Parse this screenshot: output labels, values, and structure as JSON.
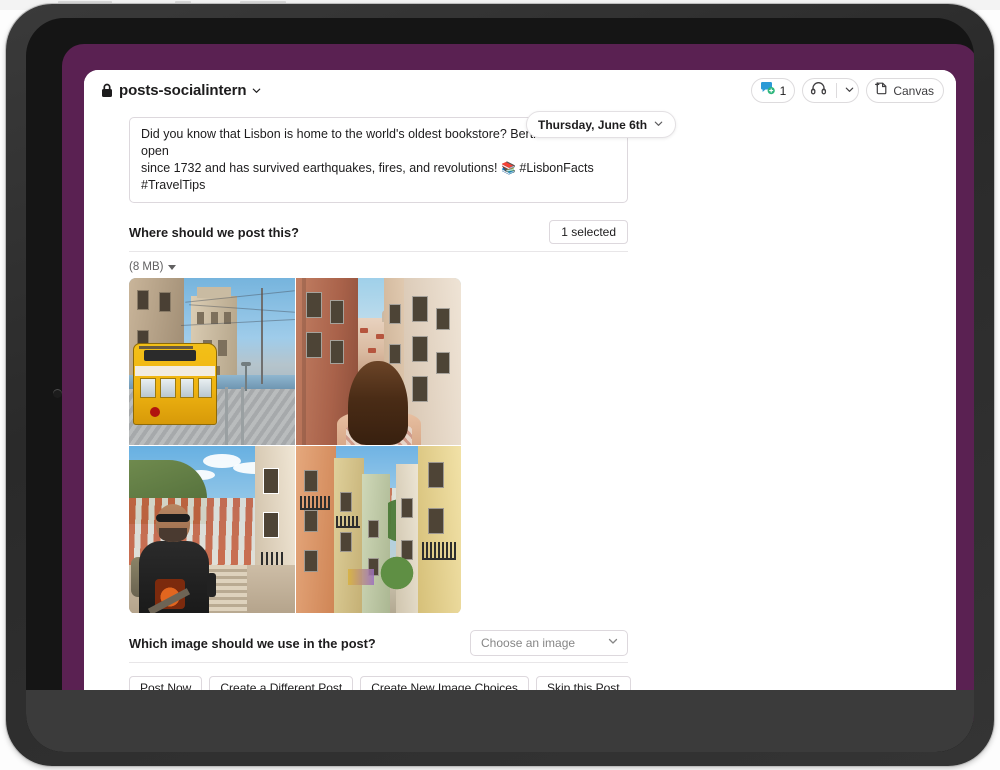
{
  "device": {
    "kind": "tablet-frame"
  },
  "channel": {
    "icon": "lock-icon",
    "name": "posts-socialintern",
    "chevron": "chevron-down-icon"
  },
  "header_actions": {
    "members": {
      "icon": "members-icon",
      "count": "1"
    },
    "huddle": {
      "icon": "headphones-icon",
      "chevron": "chevron-down-icon"
    },
    "canvas": {
      "icon": "canvas-icon",
      "label": "Canvas"
    }
  },
  "date_pill": {
    "label": "Thursday, June 6th",
    "chevron": "chevron-down-icon"
  },
  "composer": {
    "text_line1": "Did you know that Lisbon is home to the world's oldest bookstore? Bertrand has been open",
    "text_line2_a": "since 1732 and has survived earthquakes, fires, and revolutions!",
    "emoji": "📚",
    "text_line2_b": "#LisbonFacts #TravelTips"
  },
  "where_field": {
    "label": "Where should we post this?",
    "button_label": "1 selected"
  },
  "attachment": {
    "size_label": "(8 MB)",
    "caret": "caret-down-icon",
    "images": [
      {
        "alt": "yellow-tram-belem-tower"
      },
      {
        "alt": "woman-looking-down-lisbon-street"
      },
      {
        "alt": "man-with-sunglasses-on-stairs"
      },
      {
        "alt": "colorful-lisbon-street-view"
      }
    ]
  },
  "image_field": {
    "label": "Which image should we use in the post?",
    "select_placeholder": "Choose an image",
    "chevron": "chevron-down-icon"
  },
  "actions": [
    {
      "label": "Post Now",
      "name": "post-now-button"
    },
    {
      "label": "Create a Different Post",
      "name": "create-different-post-button"
    },
    {
      "label": "Create New Image Choices",
      "name": "create-new-image-choices-button"
    },
    {
      "label": "Skip this Post",
      "name": "skip-this-post-button"
    }
  ],
  "colors": {
    "slack_purple": "#5a2152",
    "text_primary": "#1d1c1d",
    "text_muted": "#616061",
    "border": "#ddd8dd"
  }
}
